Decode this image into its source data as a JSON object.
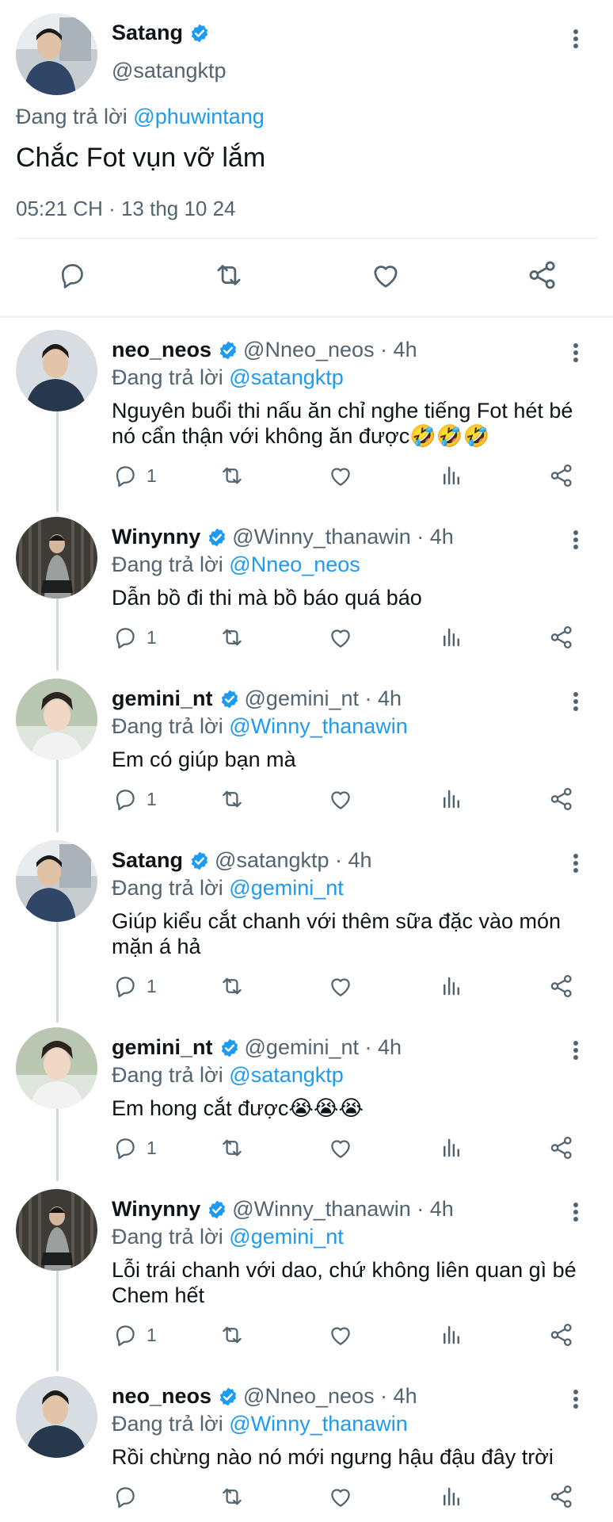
{
  "main_tweet": {
    "name": "Satang",
    "handle": "@satangktp",
    "replying_prefix": "Đang trả lời",
    "replying_to": "@phuwintang",
    "text": "Chắc Fot vụn vỡ lắm",
    "timestamp": "05:21 CH · 13 thg 10 24",
    "actions": [
      "reply-icon",
      "retweet-icon",
      "like-icon",
      "share-icon"
    ]
  },
  "replies": [
    {
      "name": "neo_neos",
      "handle_time": "@Nneo_neos · 4h",
      "replying_prefix": "Đang trả lời",
      "replying_to": "@satangktp",
      "text": "Nguyên buổi thi nấu ăn chỉ nghe tiếng Fot hét bé nó cẩn thận với không ăn được🤣🤣🤣",
      "reply_count": "1",
      "avatar_color": "#27384d"
    },
    {
      "name": "Winynny",
      "handle_time": "@Winny_thanawin · 4h",
      "replying_prefix": "Đang trả lời",
      "replying_to": "@Nneo_neos",
      "text": "Dẫn bồ đi thi mà bồ báo quá báo",
      "reply_count": "1",
      "avatar_color": "#5a5650"
    },
    {
      "name": "gemini_nt",
      "handle_time": "@gemini_nt · 4h",
      "replying_prefix": "Đang trả lời",
      "replying_to": "@Winny_thanawin",
      "text": "Em có giúp bạn mà",
      "reply_count": "1",
      "avatar_color": "#c9c2b6"
    },
    {
      "name": "Satang",
      "handle_time": "@satangktp · 4h",
      "replying_prefix": "Đang trả lời",
      "replying_to": "@gemini_nt",
      "text": "Giúp kiểu cắt chanh với thêm sữa đặc vào món mặn á hả",
      "reply_count": "1",
      "avatar_color": "#3f4d60"
    },
    {
      "name": "gemini_nt",
      "handle_time": "@gemini_nt · 4h",
      "replying_prefix": "Đang trả lời",
      "replying_to": "@satangktp",
      "text": "Em hong cắt được😭😭😭",
      "reply_count": "1",
      "avatar_color": "#c9c2b6"
    },
    {
      "name": "Winynny",
      "handle_time": "@Winny_thanawin · 4h",
      "replying_prefix": "Đang trả lời",
      "replying_to": "@gemini_nt",
      "text": "Lỗi trái chanh với dao, chứ không liên quan gì bé Chem hết",
      "reply_count": "1",
      "avatar_color": "#5a5650"
    },
    {
      "name": "neo_neos",
      "handle_time": "@Nneo_neos · 4h",
      "replying_prefix": "Đang trả lời",
      "replying_to": "@Winny_thanawin",
      "text": "Rồi chừng nào nó mới ngưng hậu đậu đây trời",
      "reply_count": "",
      "avatar_color": "#27384d"
    }
  ],
  "colors": {
    "link": "#1d9bf0",
    "verified": "#1d9bf0",
    "muted": "#536471",
    "text": "#0f1419"
  }
}
